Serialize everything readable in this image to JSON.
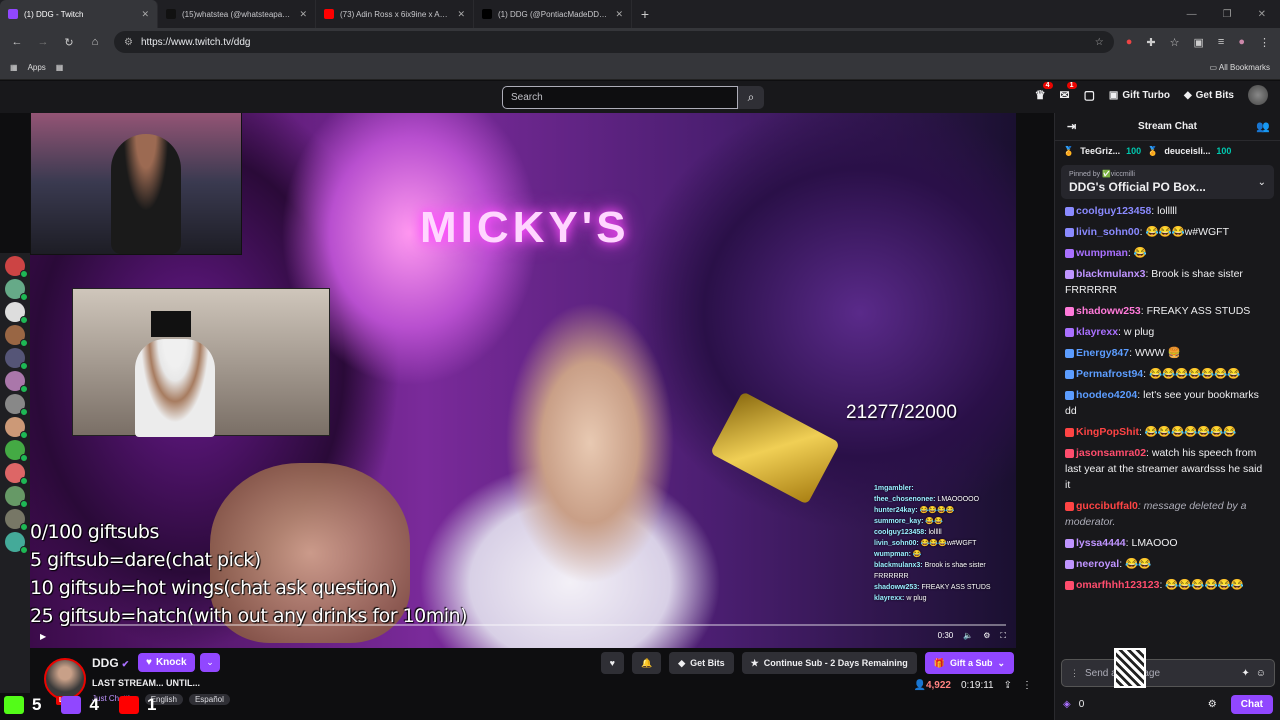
{
  "browser": {
    "tabs": [
      {
        "title": "(1) DDG - Twitch",
        "color": "#9147ff",
        "active": true
      },
      {
        "title": "(15)whatstea (@whatsteapage)",
        "color": "#111111",
        "active": false
      },
      {
        "title": "(73) Adin Ross x 6ix9ine x Akad",
        "color": "#ff0000",
        "active": false
      },
      {
        "title": "(1) DDG (@PontiacMadeDDG) /",
        "color": "#000000",
        "active": false
      }
    ],
    "url": "https://www.twitch.tv/ddg",
    "bookmarks": {
      "apps": "Apps",
      "all": "All Bookmarks"
    }
  },
  "twitch_nav": {
    "search_placeholder": "Search",
    "badge_inbox": "4",
    "badge_notif": "1",
    "gift_turbo": "Gift Turbo",
    "get_bits": "Get Bits"
  },
  "player": {
    "neon": "MICKY'S",
    "goal": "21277/22000",
    "overlay_lines": [
      "0/100 giftsubs",
      "5 giftsub=dare(chat pick)",
      "10 giftsub=hot wings(chat ask question)",
      "25 giftsub=hatch(with out any drinks for 10min)"
    ],
    "mini_chat": [
      {
        "name": "1mgambler:",
        "text": ""
      },
      {
        "name": "thee_chosenonee:",
        "text": "LMAOOOOO"
      },
      {
        "name": "hunter24kay:",
        "text": "😂😂😂😂"
      },
      {
        "name": "summore_kay:",
        "text": "😂😂"
      },
      {
        "name": "coolguy123458:",
        "text": "lolllll"
      },
      {
        "name": "livin_sohn00:",
        "text": "😂😂😂w#WGFT"
      },
      {
        "name": "wumpman:",
        "text": "😂"
      },
      {
        "name": "blackmulanx3:",
        "text": "Brook is shae sister FRRRRRR"
      },
      {
        "name": "shadoww253:",
        "text": "FREAKY ASS STUDS"
      },
      {
        "name": "klayrexx:",
        "text": "w plug"
      }
    ],
    "time": "0:30"
  },
  "stream_info": {
    "name": "DDG",
    "knock": "Knock",
    "title": "LAST STREAM... UNTIL...",
    "category": "Just Chatting",
    "tags": [
      "English",
      "Español"
    ],
    "get_bits": "Get Bits",
    "continue_sub": "Continue Sub - 2 Days Remaining",
    "gift_sub": "Gift a Sub",
    "viewers": "4,922",
    "uptime": "0:19:11",
    "live": "LIVE"
  },
  "bottom_overlay": [
    {
      "platform": "kick",
      "count": "5",
      "color": "#53fc18"
    },
    {
      "platform": "twitch",
      "count": "4",
      "color": "#9147ff"
    },
    {
      "platform": "youtube",
      "count": "1",
      "color": "#ff0000"
    }
  ],
  "chat": {
    "title": "Stream Chat",
    "leaderboard": [
      {
        "name": "TeeGriz...",
        "pts": "100"
      },
      {
        "name": "deuceisli...",
        "pts": "100"
      }
    ],
    "pinned_by": "Pinned by ✅viccmilli",
    "pinned_msg": "DDG's Official PO Box...",
    "messages": [
      {
        "user": "coolguy123458",
        "color": "#8a8aff",
        "text": ": lolllll",
        "deleted": false
      },
      {
        "user": "livin_sohn00",
        "color": "#8a8aff",
        "text": ": 😂😂😂w#WGFT",
        "deleted": false
      },
      {
        "user": "wumpman",
        "color": "#a970ff",
        "text": ": 😂",
        "deleted": false
      },
      {
        "user": "blackmulanx3",
        "color": "#bf94ff",
        "text": ": Brook is shae sister FRRRRRR",
        "deleted": false
      },
      {
        "user": "shadoww253",
        "color": "#ff7ad9",
        "text": ": FREAKY ASS STUDS",
        "deleted": false
      },
      {
        "user": "klayrexx",
        "color": "#a970ff",
        "text": ": w plug",
        "deleted": false
      },
      {
        "user": "Energy847",
        "color": "#5c9dff",
        "text": ": WWW 🍔",
        "deleted": false
      },
      {
        "user": "Permafrost94",
        "color": "#5c9dff",
        "text": ": 😂😂😂😂😂😂😂",
        "deleted": false
      },
      {
        "user": "hoodeo4204",
        "color": "#5c9dff",
        "text": ": let's see your bookmarks dd",
        "deleted": false
      },
      {
        "user": "KingPopShit",
        "color": "#ff4444",
        "text": ": 😂😂😂😂😂😂😂",
        "deleted": false
      },
      {
        "user": "jasonsamra02",
        "color": "#ff4d6d",
        "text": ": watch his speech from last year at the streamer awardsss he said it",
        "deleted": false
      },
      {
        "user": "guccibuffal0",
        "color": "#ff4444",
        "text": ": message deleted by a moderator.",
        "deleted": true
      },
      {
        "user": "lyssa4444",
        "color": "#bf94ff",
        "text": ": LMAOOO",
        "deleted": false
      },
      {
        "user": "neeroyal",
        "color": "#bf94ff",
        "text": ": 😂😂",
        "deleted": false
      },
      {
        "user": "omarfhhh123123",
        "color": "#ff4d6d",
        "text": ": 😂😂😂😂😂😂",
        "deleted": false
      }
    ],
    "input_placeholder": "Send a message",
    "points": "0",
    "chat_btn": "Chat"
  }
}
